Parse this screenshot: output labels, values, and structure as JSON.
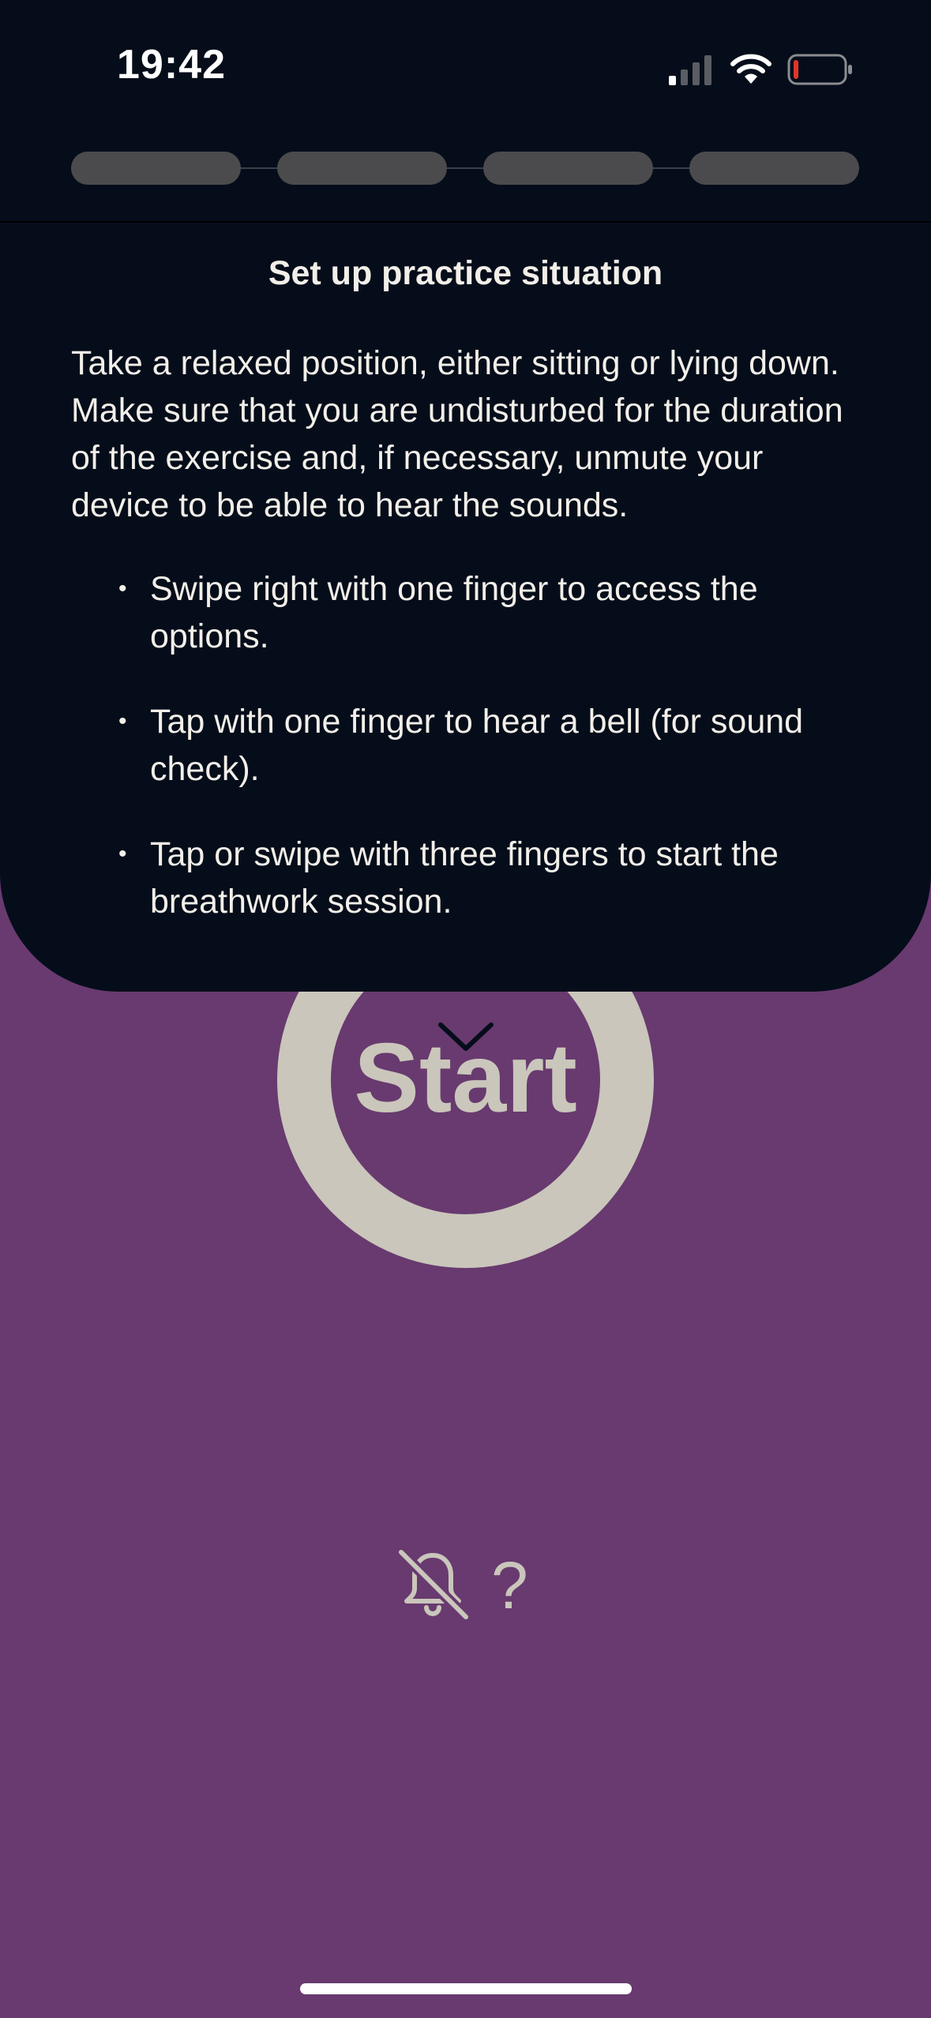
{
  "status_bar": {
    "time": "19:42",
    "signal_icon": "cellular-signal-icon",
    "wifi_icon": "wifi-icon",
    "battery_icon": "battery-low-icon"
  },
  "progress": {
    "total_steps": 4
  },
  "sheet": {
    "title": "Set up practice situation",
    "body": "Take a relaxed position, either sitting or lying down. Make sure that you are undisturbed for the duration of the exercise and, if necessary, unmute your device to be able to hear the sounds.",
    "bullet_glyph": "•",
    "instructions": [
      "Swipe right with one finger to access the options.",
      "Tap with one finger to hear a bell (for sound check).",
      "Tap or swipe with three fingers to start the breathwork session."
    ],
    "collapse_icon": "chevron-down-icon"
  },
  "start_button": {
    "label": "Start"
  },
  "controls": {
    "sound_icon": "bell-off-icon",
    "help_label": "?"
  },
  "colors": {
    "background": "#683a6f",
    "sheet": "#060d1a",
    "ring": "#cac6bb",
    "text": "#f2efe9",
    "progress_segment": "#4b4b4d",
    "battery_low": "#e0352b"
  }
}
